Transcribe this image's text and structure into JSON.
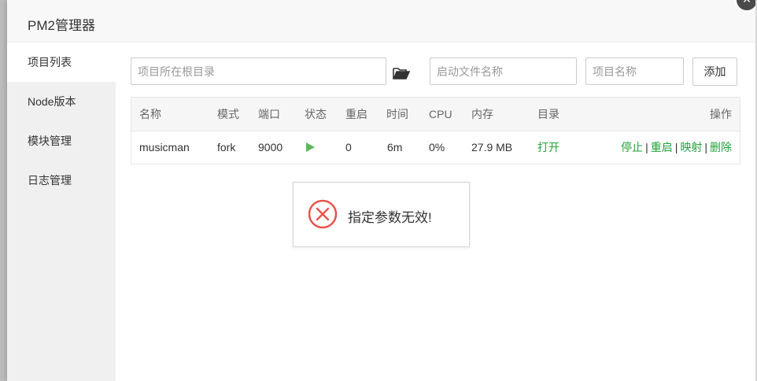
{
  "dialog": {
    "title": "PM2管理器",
    "close_glyph": "×"
  },
  "sidebar": {
    "items": [
      {
        "label": "项目列表",
        "active": true
      },
      {
        "label": "Node版本"
      },
      {
        "label": "模块管理"
      },
      {
        "label": "日志管理"
      }
    ]
  },
  "form": {
    "root_dir_placeholder": "项目所在根目录",
    "start_file_placeholder": "启动文件名称",
    "project_name_placeholder": "项目名称",
    "add_label": "添加",
    "folder_icon": "folder-open-icon"
  },
  "table": {
    "headers": {
      "name": "名称",
      "mode": "模式",
      "port": "端口",
      "status": "状态",
      "restarts": "重启",
      "time": "时间",
      "cpu": "CPU",
      "memory": "内存",
      "dir": "目录",
      "actions": "操作"
    },
    "rows": [
      {
        "name": "musicman",
        "mode": "fork",
        "port": "9000",
        "status_icon": "play-icon",
        "restarts": "0",
        "time": "6m",
        "cpu": "0%",
        "memory": "27.9 MB",
        "dir": "打开",
        "actions": {
          "stop": "停止",
          "restart": "重启",
          "map": "映射",
          "delete": "删除",
          "separator": "|"
        }
      }
    ]
  },
  "toast": {
    "message": "指定参数无效!",
    "icon": "error-circle-icon"
  },
  "colors": {
    "accent_green": "#20a53a",
    "play_green": "#5cb85c",
    "error_red": "#e8534b"
  }
}
